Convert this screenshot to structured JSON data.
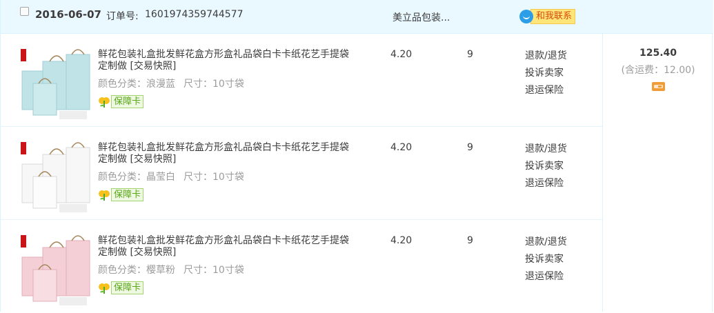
{
  "order": {
    "date": "2016-06-07",
    "order_no_label": "订单号:",
    "order_no": "1601974359744577",
    "shop_name": "美立品包装...",
    "contact_label": "和我联系"
  },
  "items": [
    {
      "title": "鲜花包装礼盒批发鲜花盒方形盒礼品袋白卡卡纸花艺手提袋定制做 [交易快照]",
      "color": "颜色分类：浪漫蓝",
      "size": "尺寸：10寸袋",
      "badge": "保障卡",
      "price": "4.20",
      "quantity": "9",
      "actions": [
        "退款/退货",
        "投诉卖家",
        "退运保险"
      ],
      "bag_color": "#bfe3e6"
    },
    {
      "title": "鲜花包装礼盒批发鲜花盒方形盒礼品袋白卡卡纸花艺手提袋定制做 [交易快照]",
      "color": "颜色分类：晶莹白",
      "size": "尺寸：10寸袋",
      "badge": "保障卡",
      "price": "4.20",
      "quantity": "9",
      "actions": [
        "退款/退货",
        "投诉卖家",
        "退运保险"
      ],
      "bag_color": "#f7f7f7"
    },
    {
      "title": "鲜花包装礼盒批发鲜花盒方形盒礼品袋白卡卡纸花艺手提袋定制做 [交易快照]",
      "color": "颜色分类：樱草粉",
      "size": "尺寸：10寸袋",
      "badge": "保障卡",
      "price": "4.20",
      "quantity": "9",
      "actions": [
        "退款/退货",
        "投诉卖家",
        "退运保险"
      ],
      "bag_color": "#f4cfd6"
    }
  ],
  "summary": {
    "total": "125.40",
    "shipping": "(含运费：12.00)"
  },
  "icons": {
    "contact": "wangwang-chat-icon",
    "badge": "guarantee-card-icon",
    "payment": "bank-card-icon"
  }
}
